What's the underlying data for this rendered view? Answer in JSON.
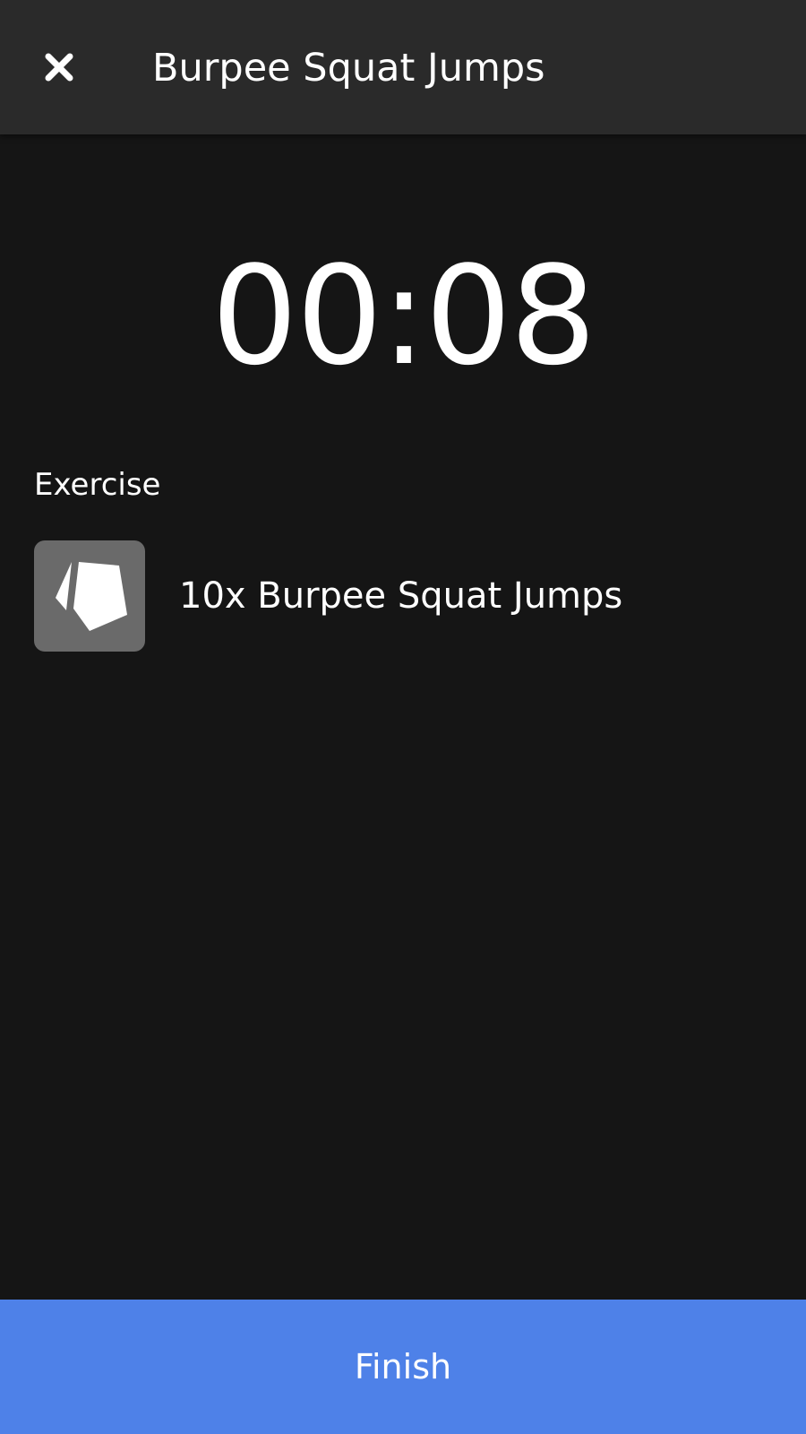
{
  "header": {
    "close_icon": "close-icon",
    "title": "Burpee Squat Jumps"
  },
  "timer": {
    "value": "00:08"
  },
  "exercise_section": {
    "label": "Exercise",
    "items": [
      {
        "thumbnail_icon": "exercise-logo-icon",
        "name": "10x Burpee Squat Jumps"
      }
    ]
  },
  "footer": {
    "finish_label": "Finish"
  },
  "colors": {
    "background": "#151515",
    "header_background": "#2a2a2a",
    "thumbnail_background": "#6a6a6a",
    "accent": "#4e81e8",
    "text": "#ffffff"
  }
}
